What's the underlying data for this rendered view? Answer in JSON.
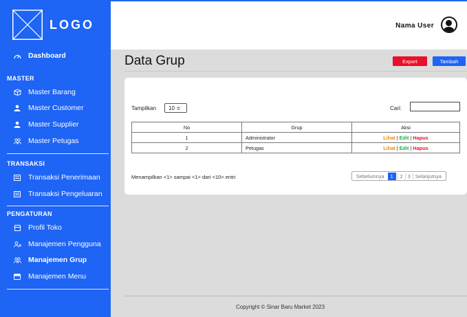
{
  "brand": {
    "logo_text": "LOGO"
  },
  "user": {
    "name": "Nama User"
  },
  "sidebar": {
    "dashboard": "Dashboard",
    "master_head": "MASTER",
    "master": [
      "Master Barang",
      "Master Customer",
      "Master Supplier",
      "Master Petugas"
    ],
    "transaksi_head": "TRANSAKSI",
    "transaksi": [
      "Transaksi Penerimaan",
      "Transaksi Pengeluaran"
    ],
    "pengaturan_head": "PENGATURAN",
    "pengaturan": [
      "Profil Toko",
      "Manajemen Pengguna",
      "Manajemen Grup",
      "Manajemen Menu"
    ]
  },
  "page": {
    "title": "Data Grup",
    "export_label": "Export",
    "tambah_label": "Tambah"
  },
  "table": {
    "show_label": "Tampilkan",
    "show_value": "10 ≑",
    "search_label": "Cari:",
    "search_value": "",
    "headers": [
      "No",
      "Grup",
      "Aksi"
    ],
    "rows": [
      {
        "no": "1",
        "grup": "Administrator"
      },
      {
        "no": "2",
        "grup": "Petugas"
      }
    ],
    "actions": {
      "lihat": "Lihat",
      "edit": "Edit",
      "hapus": "Hapus",
      "sep": "|"
    },
    "entries_text": "Menampilkan <1> sampai <1> dari <10> entri"
  },
  "pagination": {
    "prev": "Sebelumnya",
    "pages": [
      "1",
      "2",
      "3"
    ],
    "current": "1",
    "next": "Selanjutnya"
  },
  "footer": {
    "copyright": "Copyright © Sinar Baru Market 2023"
  },
  "colors": {
    "primary": "#1e64f5",
    "danger": "#e8102a",
    "warning": "#f08a00",
    "success": "#18b04a"
  },
  "icons": {
    "dashboard": "dashboard-icon",
    "barang": "box-icon",
    "customer": "user-icon",
    "supplier": "user-icon",
    "petugas": "users-icon",
    "transaksi": "receipt-icon",
    "profil": "store-icon",
    "pengguna": "user-cog-icon",
    "grup": "users-icon",
    "menu": "menu-icon"
  }
}
